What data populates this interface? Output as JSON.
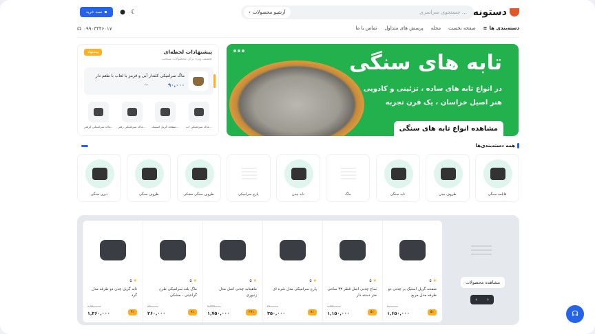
{
  "header": {
    "logo": "دستونه",
    "search_placeholder": "جستجوی سراسری ...",
    "archive_label": "آرشیو محصولات",
    "cart_label": "سبد خرید",
    "phone": "۰۹۹۰۳۴۴۶۰۱۷",
    "nav": [
      "دسته‌بندی ها",
      "صفحه نخست",
      "مجله",
      "پرسش های متداول",
      "تماس با ما"
    ]
  },
  "hero": {
    "title": "تابه های سنگی",
    "line1": "در انواع تابه های ساده ، تزئینی و کادویی",
    "line2": "هنر اصیل خراسان ، یک قرن تجربه",
    "cta": "مشاهده انواع تابه های سنگی"
  },
  "suggestions": {
    "title": "پیشنهادات لحظه‌ای",
    "subtitle": "تخفیف ویژه برای محصولات منتخب",
    "badge": "پیشنهاد",
    "featured": {
      "name": "ماگ سرامیکی کلندار آبی و قرمز با لعاب با طعم دار",
      "price": "۹۰,۰۰۰",
      "old": "۰۰"
    },
    "items": [
      {
        "name": "ماگ سرامیکی آب..."
      },
      {
        "name": "صفحه گریل استیک..."
      },
      {
        "name": "ماگ سرامیکی رفتر..."
      },
      {
        "name": "ماگ سرامیکی گرفتر..."
      }
    ]
  },
  "categories": {
    "title": "همه دسته‌بندی‌ها",
    "items": [
      {
        "name": "قابلمه سنگی",
        "style": "mint"
      },
      {
        "name": "ظروف چدن",
        "style": "mint"
      },
      {
        "name": "تابه سنگی",
        "style": "mint"
      },
      {
        "name": "ماگ",
        "style": "plain"
      },
      {
        "name": "تابه چدن",
        "style": "mint"
      },
      {
        "name": "پارچ سرامیکی",
        "style": "plain"
      },
      {
        "name": "ظروف سنگی مشکی",
        "style": "mint"
      },
      {
        "name": "ظروف سنگی",
        "style": "mint"
      },
      {
        "name": "دیزی سنگی",
        "style": "mint"
      }
    ]
  },
  "products": {
    "view_all": "مشاهده محصولات",
    "items": [
      {
        "name": "صفحه گریل استیک بر چدنی دو طرفه مدل مربع",
        "rating": "۵",
        "old": "۲۰۰,۰۰۰",
        "price": "۱,۶۵۰,۰۰۰",
        "off": "۵٪"
      },
      {
        "name": "ساج چدنی اصل قطر ۳۳ سانتی متر دسته دار",
        "rating": "۵",
        "old": "۱,۲۴۰,۰۰۰",
        "price": "۱,۱۵۰,۰۰۰",
        "off": "۵٪"
      },
      {
        "name": "پارچ سرامیکی مدل شره ای",
        "rating": "۵",
        "old": "۳۸۰,۰۰۰",
        "price": "۳۵۰,۰۰۰",
        "off": "۸٪"
      },
      {
        "name": "ماهیتابه چدنی اصل مدل زنبوری",
        "rating": "۵",
        "old": "۲,۳۳۵,۰۰۰",
        "price": "۱,۷۵۰,۰۰۰",
        "off": "۲۷٪"
      },
      {
        "name": "ماگ بلند سرامیکی طرح گرانتیتی - مشکی",
        "rating": "۵",
        "old": "۲۹۰,۰۰۰",
        "price": "۲۶۰,۰۰۰",
        "off": "۹٪"
      },
      {
        "name": "تابه گریل چدن دو طرفه مدل گرد",
        "rating": "۵",
        "old": "۱,۹۸۰,۰۰۰",
        "price": "۱,۳۶۰,۰۰۰",
        "off": "۳٪"
      }
    ]
  }
}
